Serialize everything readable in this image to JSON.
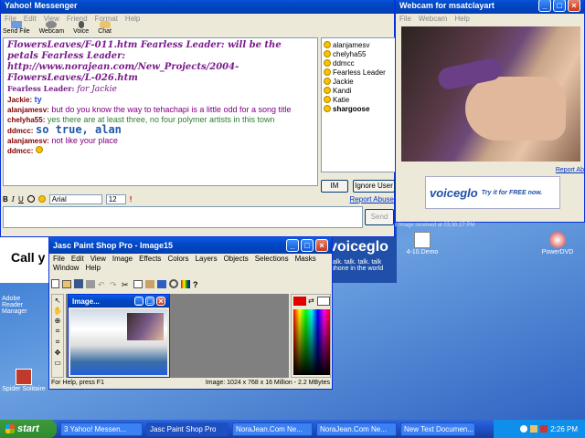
{
  "chat": {
    "title": "Yahoo! Messenger",
    "menu": [
      "File",
      "Edit",
      "View",
      "Friend",
      "Format",
      "Help"
    ],
    "toolbar": [
      "Send File",
      "Webcam",
      "Voice",
      "Chat"
    ],
    "log": [
      {
        "user": "",
        "text": "FlowersLeaves/F-011.htm Fearless Leader: will be the petals Fearless Leader: http://www.norajean.com/New_Projects/2004-FlowersLeaves/L-026.htm",
        "style": "script"
      },
      {
        "user": "Fearless Leader:",
        "text": "for Jackie",
        "style": "script"
      },
      {
        "user": "Jackie:",
        "text": "ty",
        "style": "blue"
      },
      {
        "user": "alanjamesv:",
        "text": "but do you know the way to tehachapi is a little odd for a song title",
        "style": "purple"
      },
      {
        "user": "chelyha55:",
        "text": "yes there are at least three, no four polymer artists in this town",
        "style": "green"
      },
      {
        "user": "ddmcc:",
        "text": "so true, alan",
        "style": "big"
      },
      {
        "user": "alanjamesv:",
        "text": "not like your place",
        "style": "purple"
      },
      {
        "user": "ddmcc:",
        "text": "",
        "style": "smile"
      }
    ],
    "users": [
      "alanjamesv",
      "chelyha55",
      "ddmcc",
      "Fearless Leader",
      "Jackie",
      "Kandi",
      "Katie",
      "shargoose"
    ],
    "im_label": "IM",
    "ignore_label": "Ignore User",
    "font_name": "Arial",
    "font_size": "12",
    "report_abuse": "Report Abuse",
    "send_label": "Send",
    "ad_text": "Call y"
  },
  "webcam": {
    "title": "Webcam for msatclayart",
    "menu": [
      "File",
      "Webcam",
      "Help"
    ],
    "report_abuse": "Report Ab",
    "ad_brand": "voiceglo",
    "ad_tagline": "Try it for FREE now.",
    "status": "Image received at 03:30:27 PM"
  },
  "psp": {
    "title": "Jasc Paint Shop Pro - Image15",
    "menu": [
      "File",
      "Edit",
      "View",
      "Image",
      "Effects",
      "Colors",
      "Layers",
      "Objects",
      "Selections",
      "Masks",
      "Window",
      "Help"
    ],
    "inner_title": "Image...",
    "status_left": "For Help, press F1",
    "status_right": "Image: 1024 x 768 x 16 Million - 2.2 MBytes"
  },
  "desktop": {
    "icons": [
      "4-10.Demo",
      "PowerDVD",
      "Spider Solitaire",
      "Adobe Reader Manager"
    ],
    "voiceglo_bg": "voiceglo",
    "voiceglo_tag": "talk. talk. talk. talk phone in the world"
  },
  "taskbar": {
    "start": "start",
    "tasks": [
      "3 Yahoo! Messen...",
      "Jasc Paint Shop Pro",
      "NoraJean.Com Ne...",
      "NoraJean.Com Ne...",
      "New Text Documen..."
    ],
    "clock": "2:26 PM"
  }
}
